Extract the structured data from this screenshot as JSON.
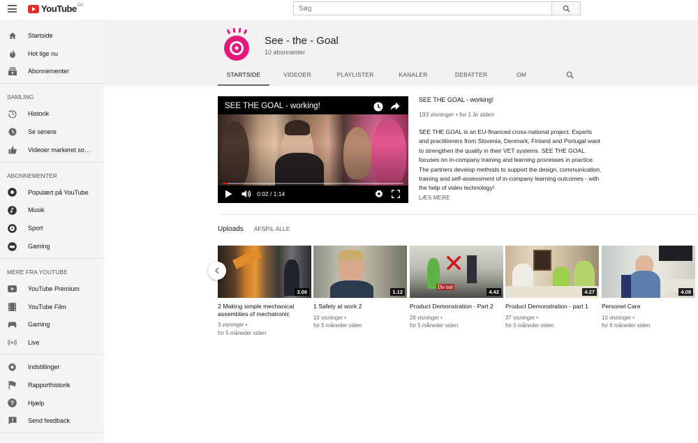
{
  "topbar": {
    "logo_text": "YouTube",
    "logo_country": "DK",
    "search_placeholder": "Søg"
  },
  "sidebar": {
    "main": [
      {
        "label": "Startside",
        "icon": "home-icon"
      },
      {
        "label": "Hot lige nu",
        "icon": "flame-icon"
      },
      {
        "label": "Abonnementer",
        "icon": "subscriptions-icon"
      }
    ],
    "library_title": "SAMLING",
    "library": [
      {
        "label": "Historik",
        "icon": "history-icon"
      },
      {
        "label": "Se senere",
        "icon": "clock-icon"
      },
      {
        "label": "Videoer markeret som \"Synes godt om\"",
        "icon": "thumbs-up-icon"
      }
    ],
    "subs_title": "ABONNEMENTER",
    "subs": [
      {
        "label": "Populært på YouTube",
        "icon": "popular-icon"
      },
      {
        "label": "Musik",
        "icon": "music-icon"
      },
      {
        "label": "Sport",
        "icon": "sport-icon"
      },
      {
        "label": "Gaming",
        "icon": "gaming-icon"
      }
    ],
    "more_title": "MERE FRA YOUTUBE",
    "more": [
      {
        "label": "YouTube Premium",
        "icon": "youtube-premium-icon"
      },
      {
        "label": "YouTube Film",
        "icon": "film-icon"
      },
      {
        "label": "Gaming",
        "icon": "gamepad-icon"
      },
      {
        "label": "Live",
        "icon": "live-icon"
      }
    ],
    "settings": [
      {
        "label": "Indstillinger",
        "icon": "gear-icon"
      },
      {
        "label": "Rapporthistorik",
        "icon": "flag-icon"
      },
      {
        "label": "Hjælp",
        "icon": "help-icon"
      },
      {
        "label": "Send feedback",
        "icon": "feedback-icon"
      }
    ]
  },
  "channel": {
    "name": "See - the - Goal",
    "subscribers": "10 abonnenter",
    "brand_color": "#e5197a",
    "tabs": [
      "STARTSIDE",
      "VIDEOER",
      "PLAYLISTER",
      "KANALER",
      "DEBATTER",
      "OM"
    ],
    "active_tab": "STARTSIDE"
  },
  "featured": {
    "player_title": "SEE THE GOAL - working!",
    "time": "0:02 / 1:14",
    "progress": 0.027,
    "title": "SEE THE GOAL - working!",
    "meta": "193 visninger • for 1 år siden",
    "description": "SEE THE GOAL is an EU-financed cross-national project. Experts and practitioners from Slovenia, Denmark, Finland and Portugal want to strengthen the quality in their VET systems. SEE THE GOAL focuses on in-company training and learning processes in practice. The partners develop methods to support the design, communication, training and self-assessment of in-company learning outcomes - with the help of video technology!",
    "read_more": "LÆS MERE"
  },
  "uploads": {
    "title": "Uploads",
    "play_all": "AFSPIL ALLE",
    "videos": [
      {
        "title": "2 Making simple mechanical assemblies of mechatronic",
        "duration": "3.06",
        "views": "3 visninger •",
        "age": "for 5 måneder siden"
      },
      {
        "title": "1 Safety at work 2",
        "duration": "1.12",
        "views": "10 visninger •",
        "age": "for 5 måneder siden"
      },
      {
        "title": "Product Demonstration - Part 2",
        "duration": "4.42",
        "views": "28 visninger •",
        "age": "for 5 måneder siden"
      },
      {
        "title": "Product Demonstration - part 1",
        "duration": "4.27",
        "views": "37 visninger •",
        "age": "for 5 måneder siden"
      },
      {
        "title": "Personel Care",
        "duration": "4.08",
        "views": "10 visninger •",
        "age": "for 6 måneder siden"
      }
    ]
  }
}
